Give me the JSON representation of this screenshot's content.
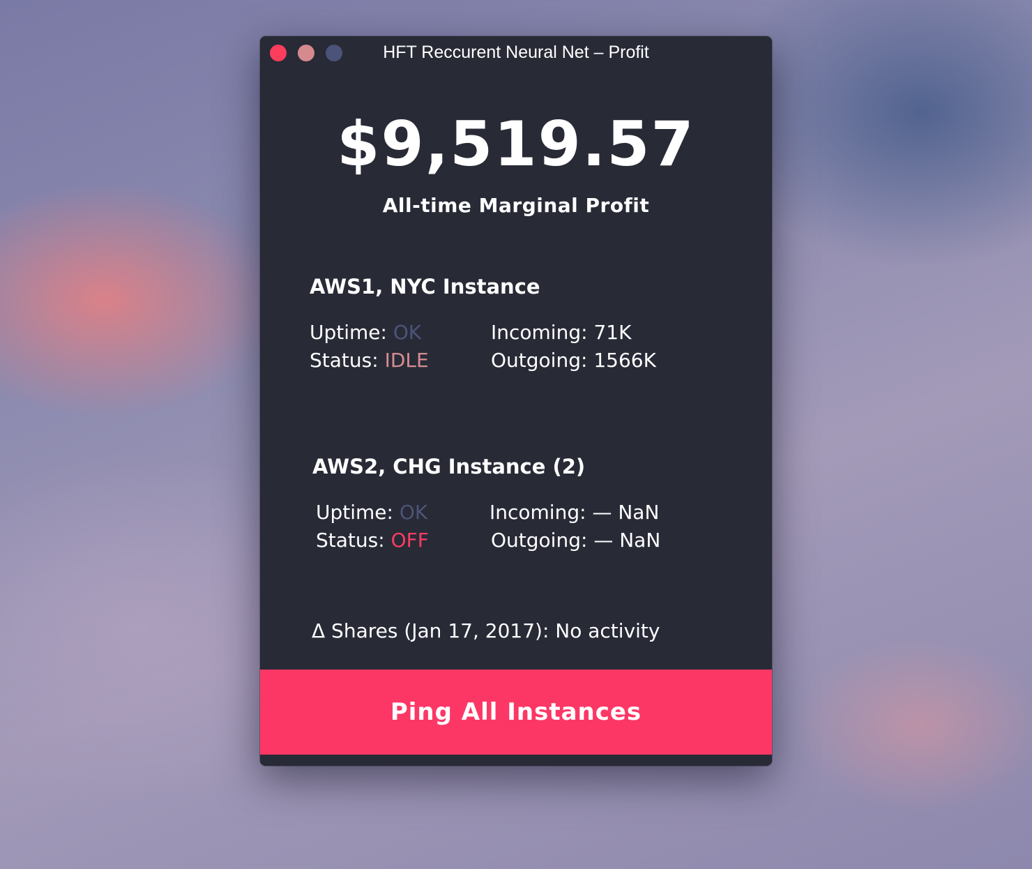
{
  "window": {
    "title": "HFT Reccurent Neural Net – Profit"
  },
  "profit": {
    "amount": "$9,519.57",
    "label": "All-time Marginal Profit"
  },
  "instances": [
    {
      "name": "AWS1, NYC Instance",
      "uptime_label": "Uptime:",
      "uptime_value": "OK",
      "status_label": "Status:",
      "status_value": "IDLE",
      "incoming_label": "Incoming:",
      "incoming_value": "71K",
      "outgoing_label": "Outgoing:",
      "outgoing_value": "1566K"
    },
    {
      "name": "AWS2, CHG Instance (2)",
      "uptime_label": "Uptime:",
      "uptime_value": "OK",
      "status_label": "Status:",
      "status_value": "OFF",
      "incoming_label": "Incoming:",
      "incoming_value": "— NaN",
      "outgoing_label": "Outgoing:",
      "outgoing_value": "— NaN"
    }
  ],
  "shares": {
    "label": "Δ Shares (Jan 17, 2017):",
    "value": "No activity"
  },
  "actions": {
    "ping_label": "Ping All Instances"
  },
  "colors": {
    "window_bg": "#282a36",
    "accent": "#fc3766",
    "ok": "#4c5578",
    "idle": "#d68e92",
    "off": "#fc3d63"
  }
}
